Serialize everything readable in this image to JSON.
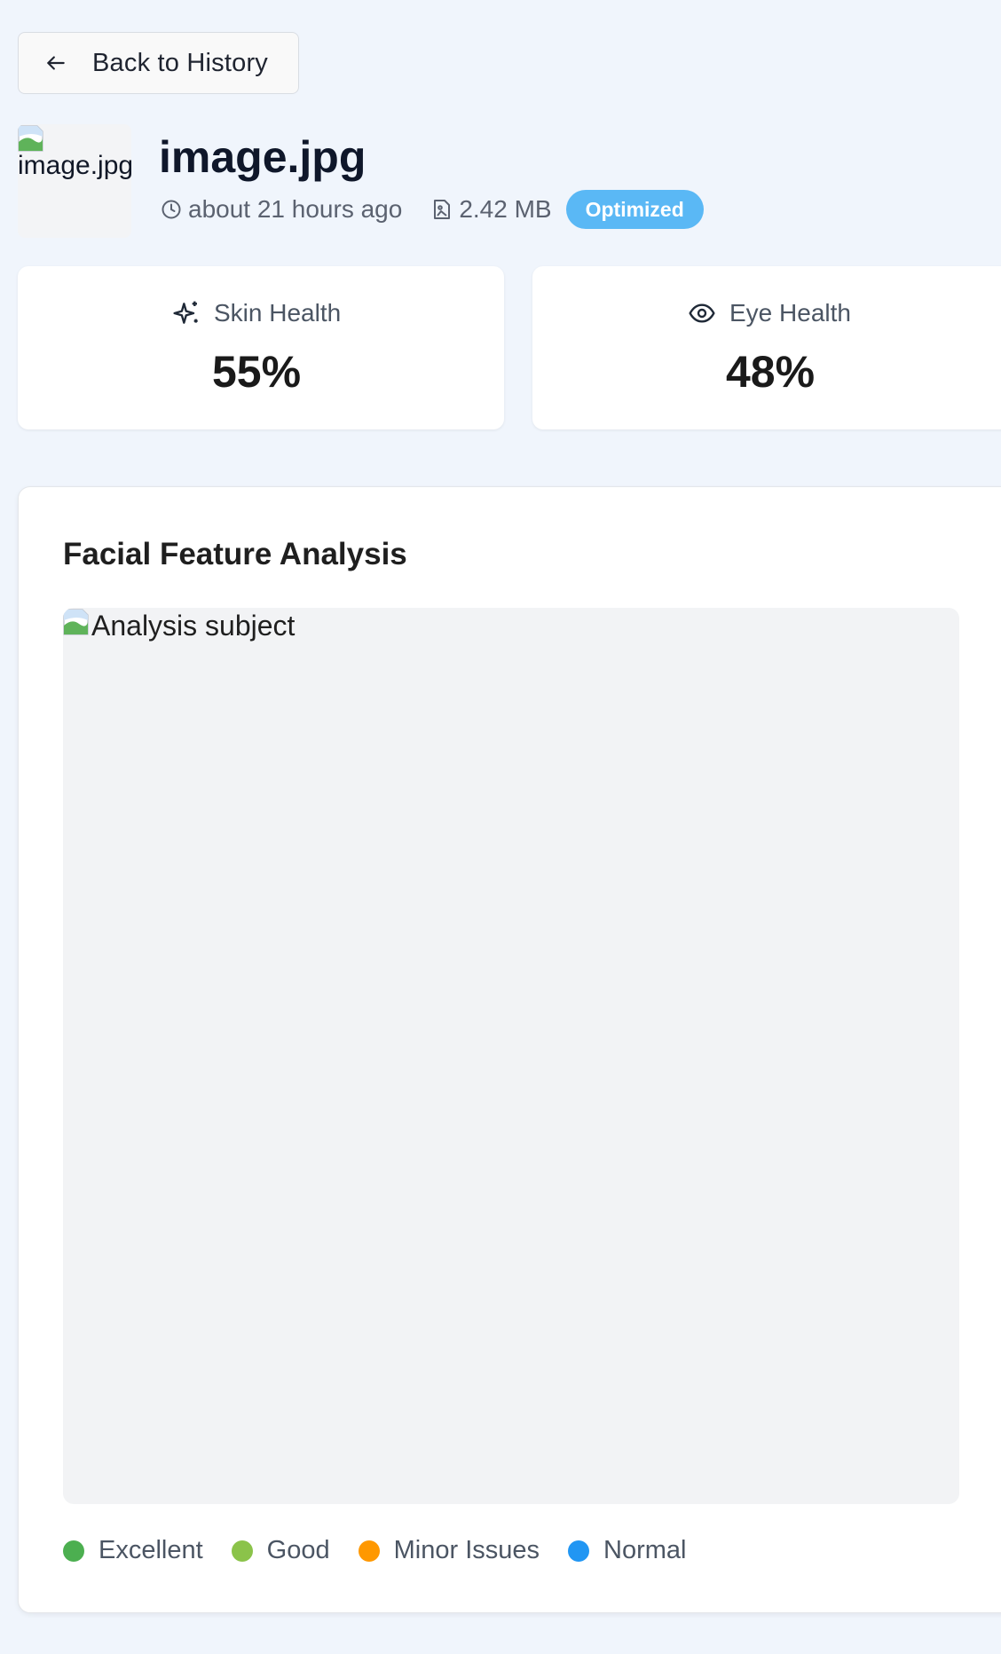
{
  "back_button": {
    "label": "Back to History",
    "icon": "arrow-left-icon"
  },
  "file": {
    "thumbnail_alt": "image.jpg",
    "name": "image.jpg",
    "time": "about 21 hours ago",
    "size": "2.42 MB",
    "status_badge": "Optimized",
    "badge_color": "#5ab8f5"
  },
  "stats": {
    "skin": {
      "label": "Skin Health",
      "value": "55%",
      "icon": "sparkles-icon"
    },
    "eye": {
      "label": "Eye Health",
      "value": "48%",
      "icon": "eye-icon"
    }
  },
  "analysis": {
    "title": "Facial Feature Analysis",
    "image_alt": "Analysis subject",
    "legend": [
      {
        "label": "Excellent",
        "color": "#4caf50"
      },
      {
        "label": "Good",
        "color": "#8bc34a"
      },
      {
        "label": "Minor Issues",
        "color": "#ff9800"
      },
      {
        "label": "Normal",
        "color": "#2196f3"
      }
    ]
  }
}
